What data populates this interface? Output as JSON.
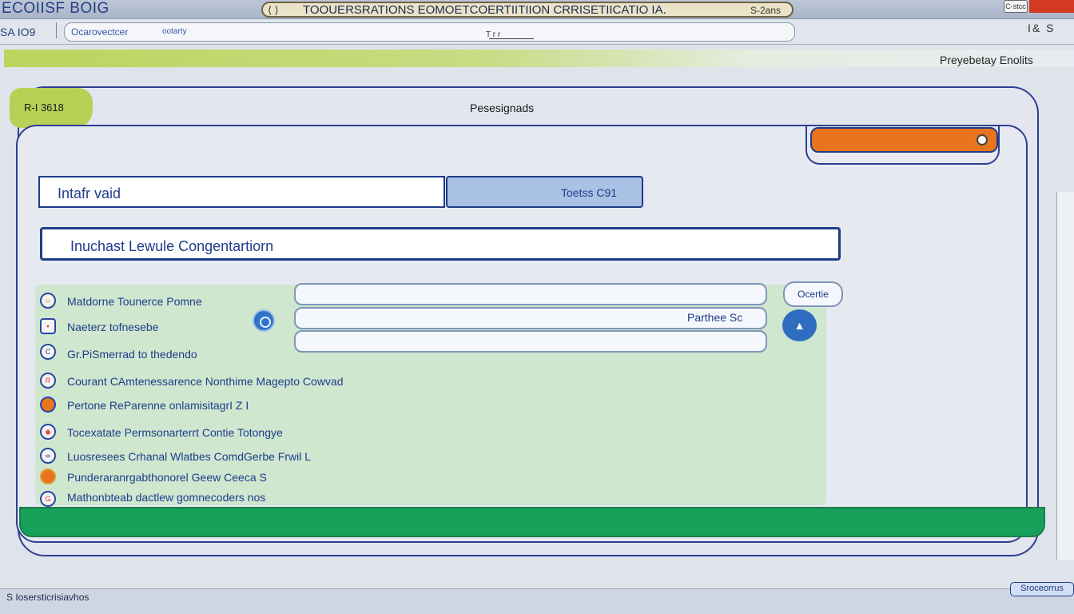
{
  "titlebar": {
    "app_name": "ECOIISF BOIG",
    "window_title": "TOOUERSRATIONS EOMOETCOERTIITIION CRRISETIICATIO IA.",
    "right_text": "S-2ans",
    "box_label": "C-stcc"
  },
  "toolbar": {
    "left_text": "SA  IO9",
    "search_text": "Ocarovectcer",
    "search_small": "ootarty",
    "mid_text": "T  r  r",
    "right_text": "I&  S"
  },
  "header": {
    "top_right_label": "Preyebetay Enolits"
  },
  "panel": {
    "tag_label": "R-I 3618",
    "title": "Pesesignads"
  },
  "form": {
    "name_field_value": "Intafr vaid",
    "toets_button": "Toetss C91",
    "long_field_value": "Inuchast Lewule Congentartiorn",
    "secondary_field_value": "Parthee Sc",
    "oc_button": "Ocertie"
  },
  "list": {
    "items": [
      {
        "label": "Matdorne Tounerce Pomne",
        "icon": "smiley-icon"
      },
      {
        "label": "Naeterz tofnesebe",
        "icon": "tag-icon"
      },
      {
        "label": "Gr.PiSmerrad to thedendo",
        "icon": "c-circle-icon"
      },
      {
        "label": "Courant CAmtenessarence Nonthime Magepto Cowvad",
        "icon": "r-circle-icon"
      },
      {
        "label": "Pertone ReParenne onlamisitagrI Z I",
        "icon": "orange-dot-icon"
      },
      {
        "label": "Tocexatate Permsonarterrt Contie Totongye",
        "icon": "camera-icon"
      },
      {
        "label": "Luosresees Crhanal Wlatbes ComdGerbe Frwil L",
        "icon": "link-icon"
      },
      {
        "label": "Punderaranrgabthonorel Geew Ceeca S",
        "icon": "orange-dot-icon"
      },
      {
        "label": "Mathonbteab dactlew gomnecoders nos",
        "icon": "g-circle-icon"
      }
    ]
  },
  "statusbar": {
    "text": "S Iosersticrisiavhos",
    "button": "Sroceorrus"
  },
  "colors": {
    "accent_blue": "#1f3c8a",
    "orange": "#e8741e",
    "green_bar": "#17a05a",
    "green_area": "#cfe7cf",
    "lime_tag": "#b7d055"
  }
}
